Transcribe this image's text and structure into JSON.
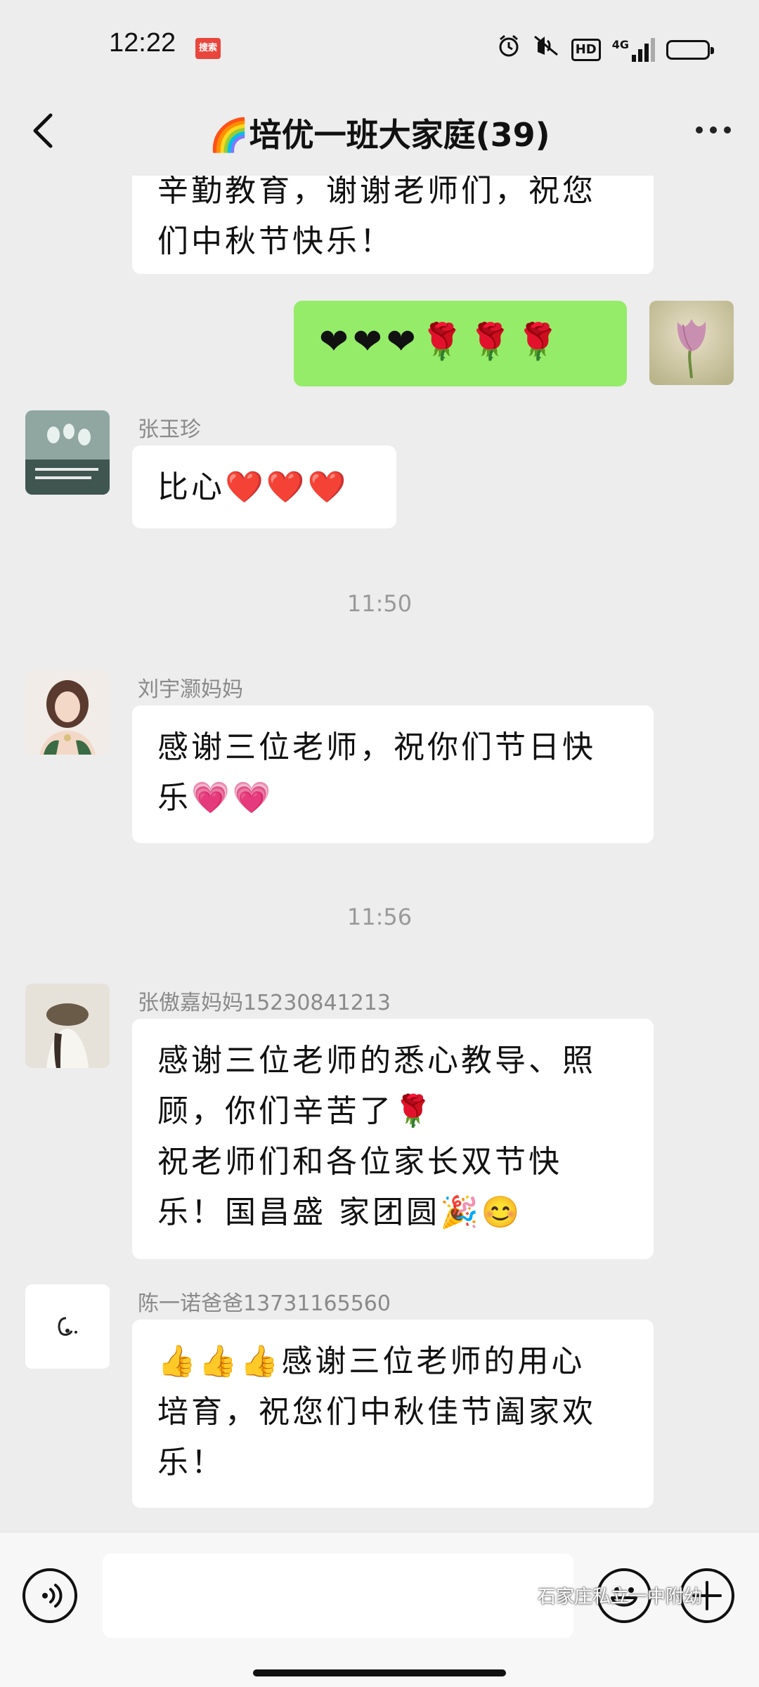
{
  "status_bar": {
    "time": "12:22",
    "app_badge": "搜索",
    "network": "4G",
    "hd_label": "HD",
    "icons": [
      "alarm-icon",
      "mute-icon",
      "hd-icon",
      "signal-icon",
      "battery-icon"
    ]
  },
  "header": {
    "title": "🌈培优一班大家庭(39)",
    "back_icon": "chevron-left-icon",
    "more_icon": "more-dots-icon"
  },
  "messages": [
    {
      "type": "incoming_partial",
      "text": "辛勤教育，谢谢老师们，祝您\n们中秋节快乐！"
    },
    {
      "type": "outgoing",
      "text": "❤❤❤🌹🌹🌹"
    },
    {
      "type": "incoming",
      "sender": "张玉珍",
      "text": "比心❤️❤️❤️"
    },
    {
      "type": "timestamp",
      "text": "11:50"
    },
    {
      "type": "incoming",
      "sender": "刘宇灏妈妈",
      "text": "感谢三位老师，祝你们节日快\n乐💗💗"
    },
    {
      "type": "timestamp",
      "text": "11:56"
    },
    {
      "type": "incoming",
      "sender": "张傲嘉妈妈15230841213",
      "text": "感谢三位老师的悉心教导、照\n顾，你们辛苦了🌹\n祝老师们和各位家长双节快\n乐！国昌盛 家团圆🎉😊"
    },
    {
      "type": "incoming",
      "sender": "陈一诺爸爸13731165560",
      "text": "👍👍👍感谢三位老师的用心\n培育，祝您们中秋佳节阖家欢\n乐！"
    }
  ],
  "bottom_bar": {
    "voice_icon": "voice-icon",
    "emoji_icon": "emoji-icon",
    "plus_icon": "plus-icon",
    "input_value": ""
  },
  "watermark": "石家庄私立一中附幼",
  "colors": {
    "background": "#ededed",
    "outgoing_bubble": "#95ec69",
    "incoming_bubble": "#ffffff"
  }
}
